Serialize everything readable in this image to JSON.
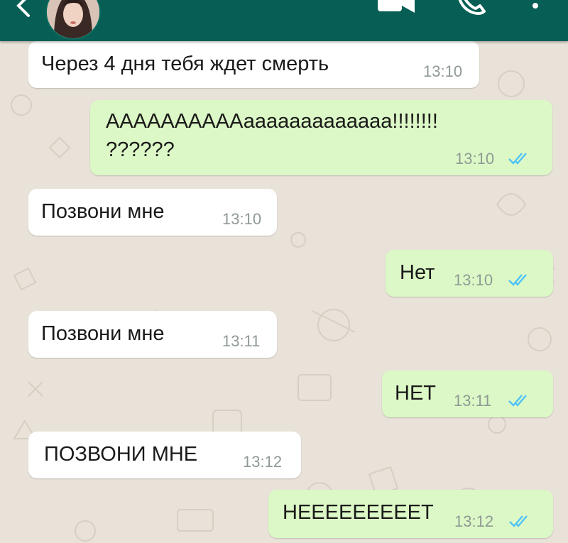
{
  "header": {
    "back_icon": "arrow-left-icon",
    "avatar": "contact-avatar",
    "video_icon": "video-call-icon",
    "call_icon": "phone-call-icon",
    "menu_icon": "more-vert-icon",
    "color": "#075e54"
  },
  "colors": {
    "incoming_bubble": "#ffffff",
    "outgoing_bubble": "#dcf8c6",
    "read_ticks": "#4fc3f7",
    "timestamp": "#8f9a94"
  },
  "messages": [
    {
      "direction": "in",
      "text": "Через 4 дня тебя ждет смерть",
      "time": "13:10"
    },
    {
      "direction": "out",
      "lines": [
        "ААААААААААааааааааааааа!!!!!!!!",
        "??????"
      ],
      "time": "13:10",
      "status": "read"
    },
    {
      "direction": "in",
      "text": "Позвони мне",
      "time": "13:10"
    },
    {
      "direction": "out",
      "text": "Нет",
      "time": "13:10",
      "status": "read"
    },
    {
      "direction": "in",
      "text": "Позвони мне",
      "time": "13:11"
    },
    {
      "direction": "out",
      "text": "НЕТ",
      "time": "13:11",
      "status": "read"
    },
    {
      "direction": "in",
      "text": "ПОЗВОНИ МНЕ",
      "time": "13:12"
    },
    {
      "direction": "out",
      "text": "НЕЕЕЕЕЕЕЕЕТ",
      "time": "13:12",
      "status": "read"
    }
  ]
}
